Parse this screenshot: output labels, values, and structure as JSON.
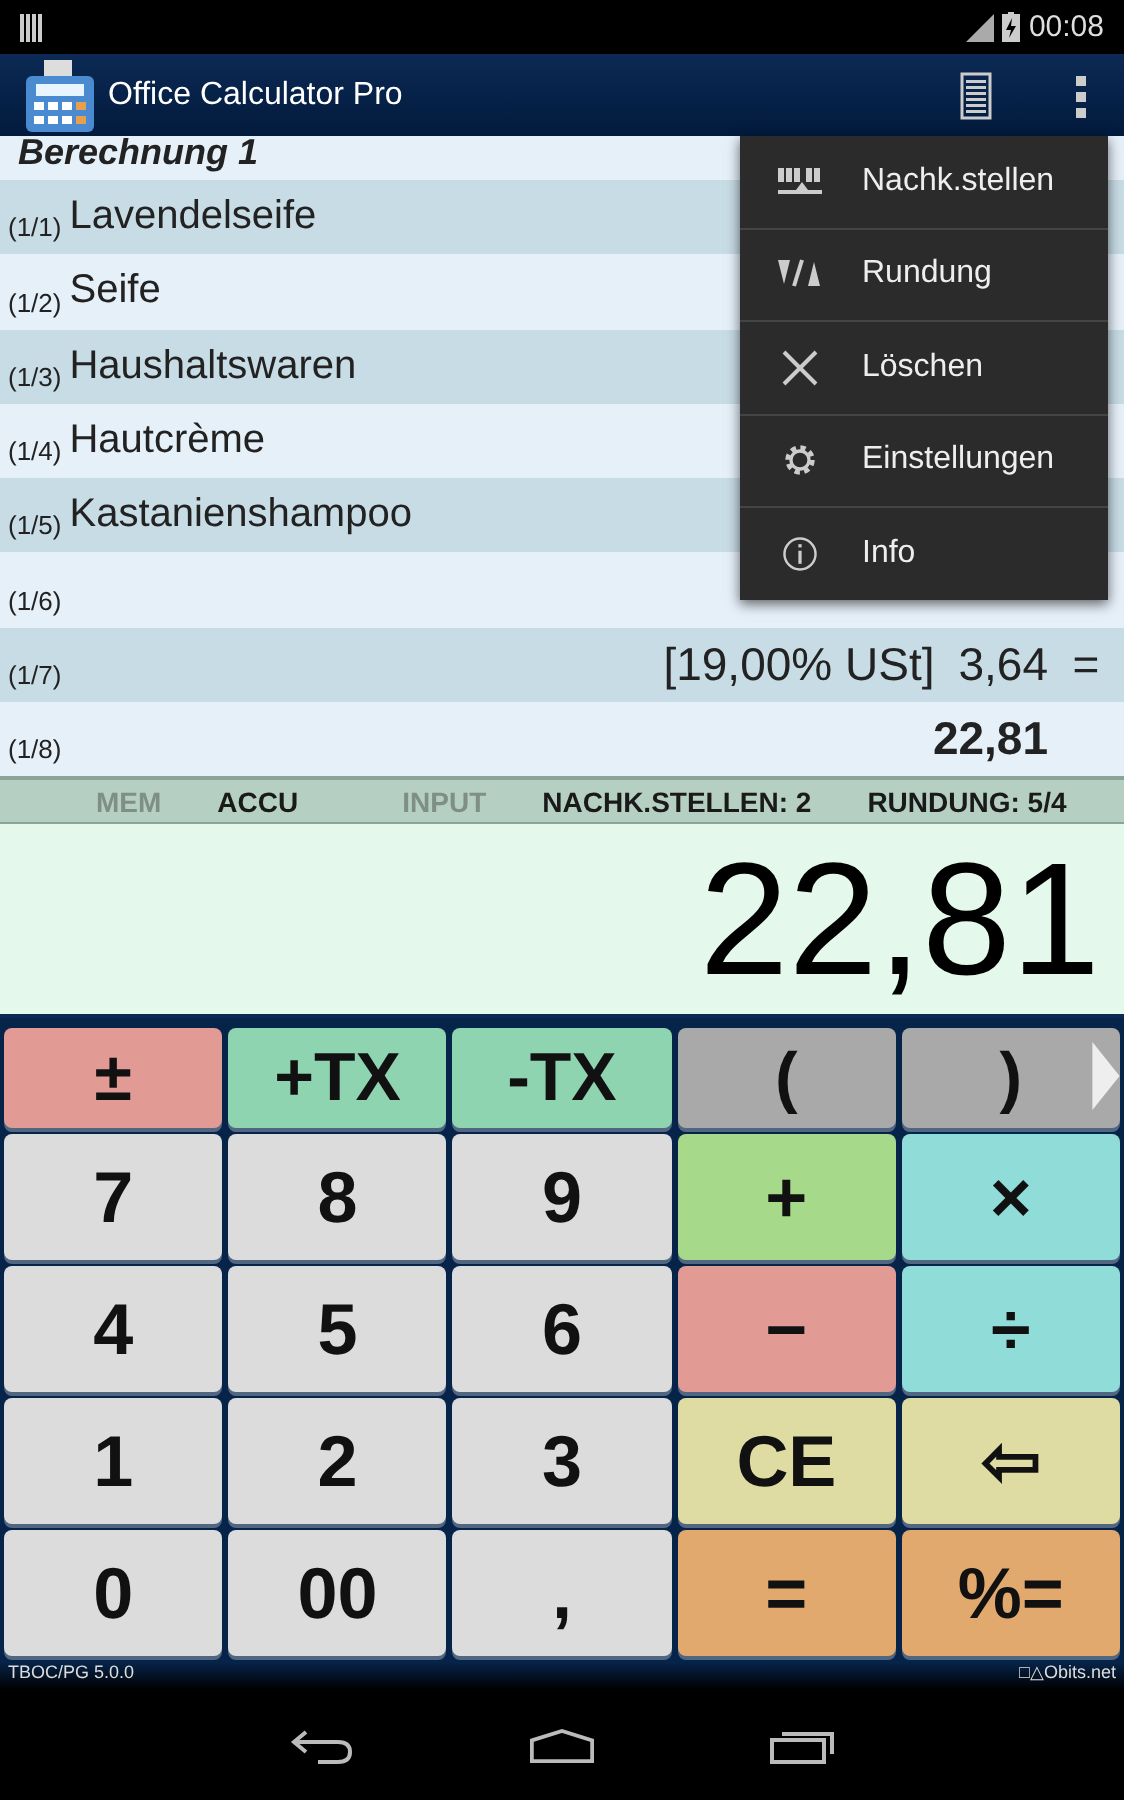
{
  "status_bar": {
    "time": "00:08"
  },
  "app_bar": {
    "title": "Office Calculator Pro"
  },
  "calculation": {
    "title": "Berechnung 1",
    "rows": [
      {
        "index": "(1/1)",
        "label": "Lavendelseife"
      },
      {
        "index": "(1/2)",
        "label": "Seife"
      },
      {
        "index": "(1/3)",
        "label": "Haushaltswaren"
      },
      {
        "index": "(1/4)",
        "label": "Hautcrème"
      },
      {
        "index": "(1/5)",
        "label": "Kastanienshampoo"
      },
      {
        "index": "(1/6)"
      },
      {
        "index": "(1/7)",
        "note": "[19,00% USt]",
        "value": "3,64",
        "op": "="
      },
      {
        "index": "(1/8)",
        "value": "22,81",
        "kind": "total"
      }
    ]
  },
  "indicators": [
    {
      "label": "MEM",
      "active": false
    },
    {
      "label": "ACCU",
      "active": true
    },
    {
      "label": "INPUT",
      "active": false
    },
    {
      "label": "NACHK.STELLEN: 2",
      "active": true
    },
    {
      "label": "RUNDUNG: 5/4",
      "active": true
    }
  ],
  "display": "22,81",
  "keys": [
    {
      "label": "±",
      "kind": "red"
    },
    {
      "label": "+TX",
      "kind": "teal"
    },
    {
      "label": "-TX",
      "kind": "teal"
    },
    {
      "label": "(",
      "kind": "dark"
    },
    {
      "label": ")",
      "kind": "dark"
    },
    {
      "label": "7",
      "kind": "grey"
    },
    {
      "label": "8",
      "kind": "grey"
    },
    {
      "label": "9",
      "kind": "grey"
    },
    {
      "label": "+",
      "kind": "green"
    },
    {
      "label": "×",
      "kind": "cyan"
    },
    {
      "label": "4",
      "kind": "grey"
    },
    {
      "label": "5",
      "kind": "grey"
    },
    {
      "label": "6",
      "kind": "grey"
    },
    {
      "label": "−",
      "kind": "red"
    },
    {
      "label": "÷",
      "kind": "cyan"
    },
    {
      "label": "1",
      "kind": "grey"
    },
    {
      "label": "2",
      "kind": "grey"
    },
    {
      "label": "3",
      "kind": "grey"
    },
    {
      "label": "CE",
      "kind": "yellow"
    },
    {
      "label": "⇦",
      "kind": "yellow"
    },
    {
      "label": "0",
      "kind": "grey"
    },
    {
      "label": "00",
      "kind": "grey"
    },
    {
      "label": ",",
      "kind": "grey"
    },
    {
      "label": "=",
      "kind": "orange"
    },
    {
      "label": "%=",
      "kind": "orange"
    }
  ],
  "footer": {
    "version": "TBOC/PG 5.0.0",
    "brand": "□△Obits.net"
  },
  "menu": [
    {
      "label": "Nachk.stellen",
      "kind": "digits"
    },
    {
      "label": "Rundung",
      "kind": "round"
    },
    {
      "label": "Löschen",
      "kind": "close"
    },
    {
      "label": "Einstellungen",
      "kind": "settings"
    },
    {
      "label": "Info",
      "kind": "info"
    }
  ]
}
